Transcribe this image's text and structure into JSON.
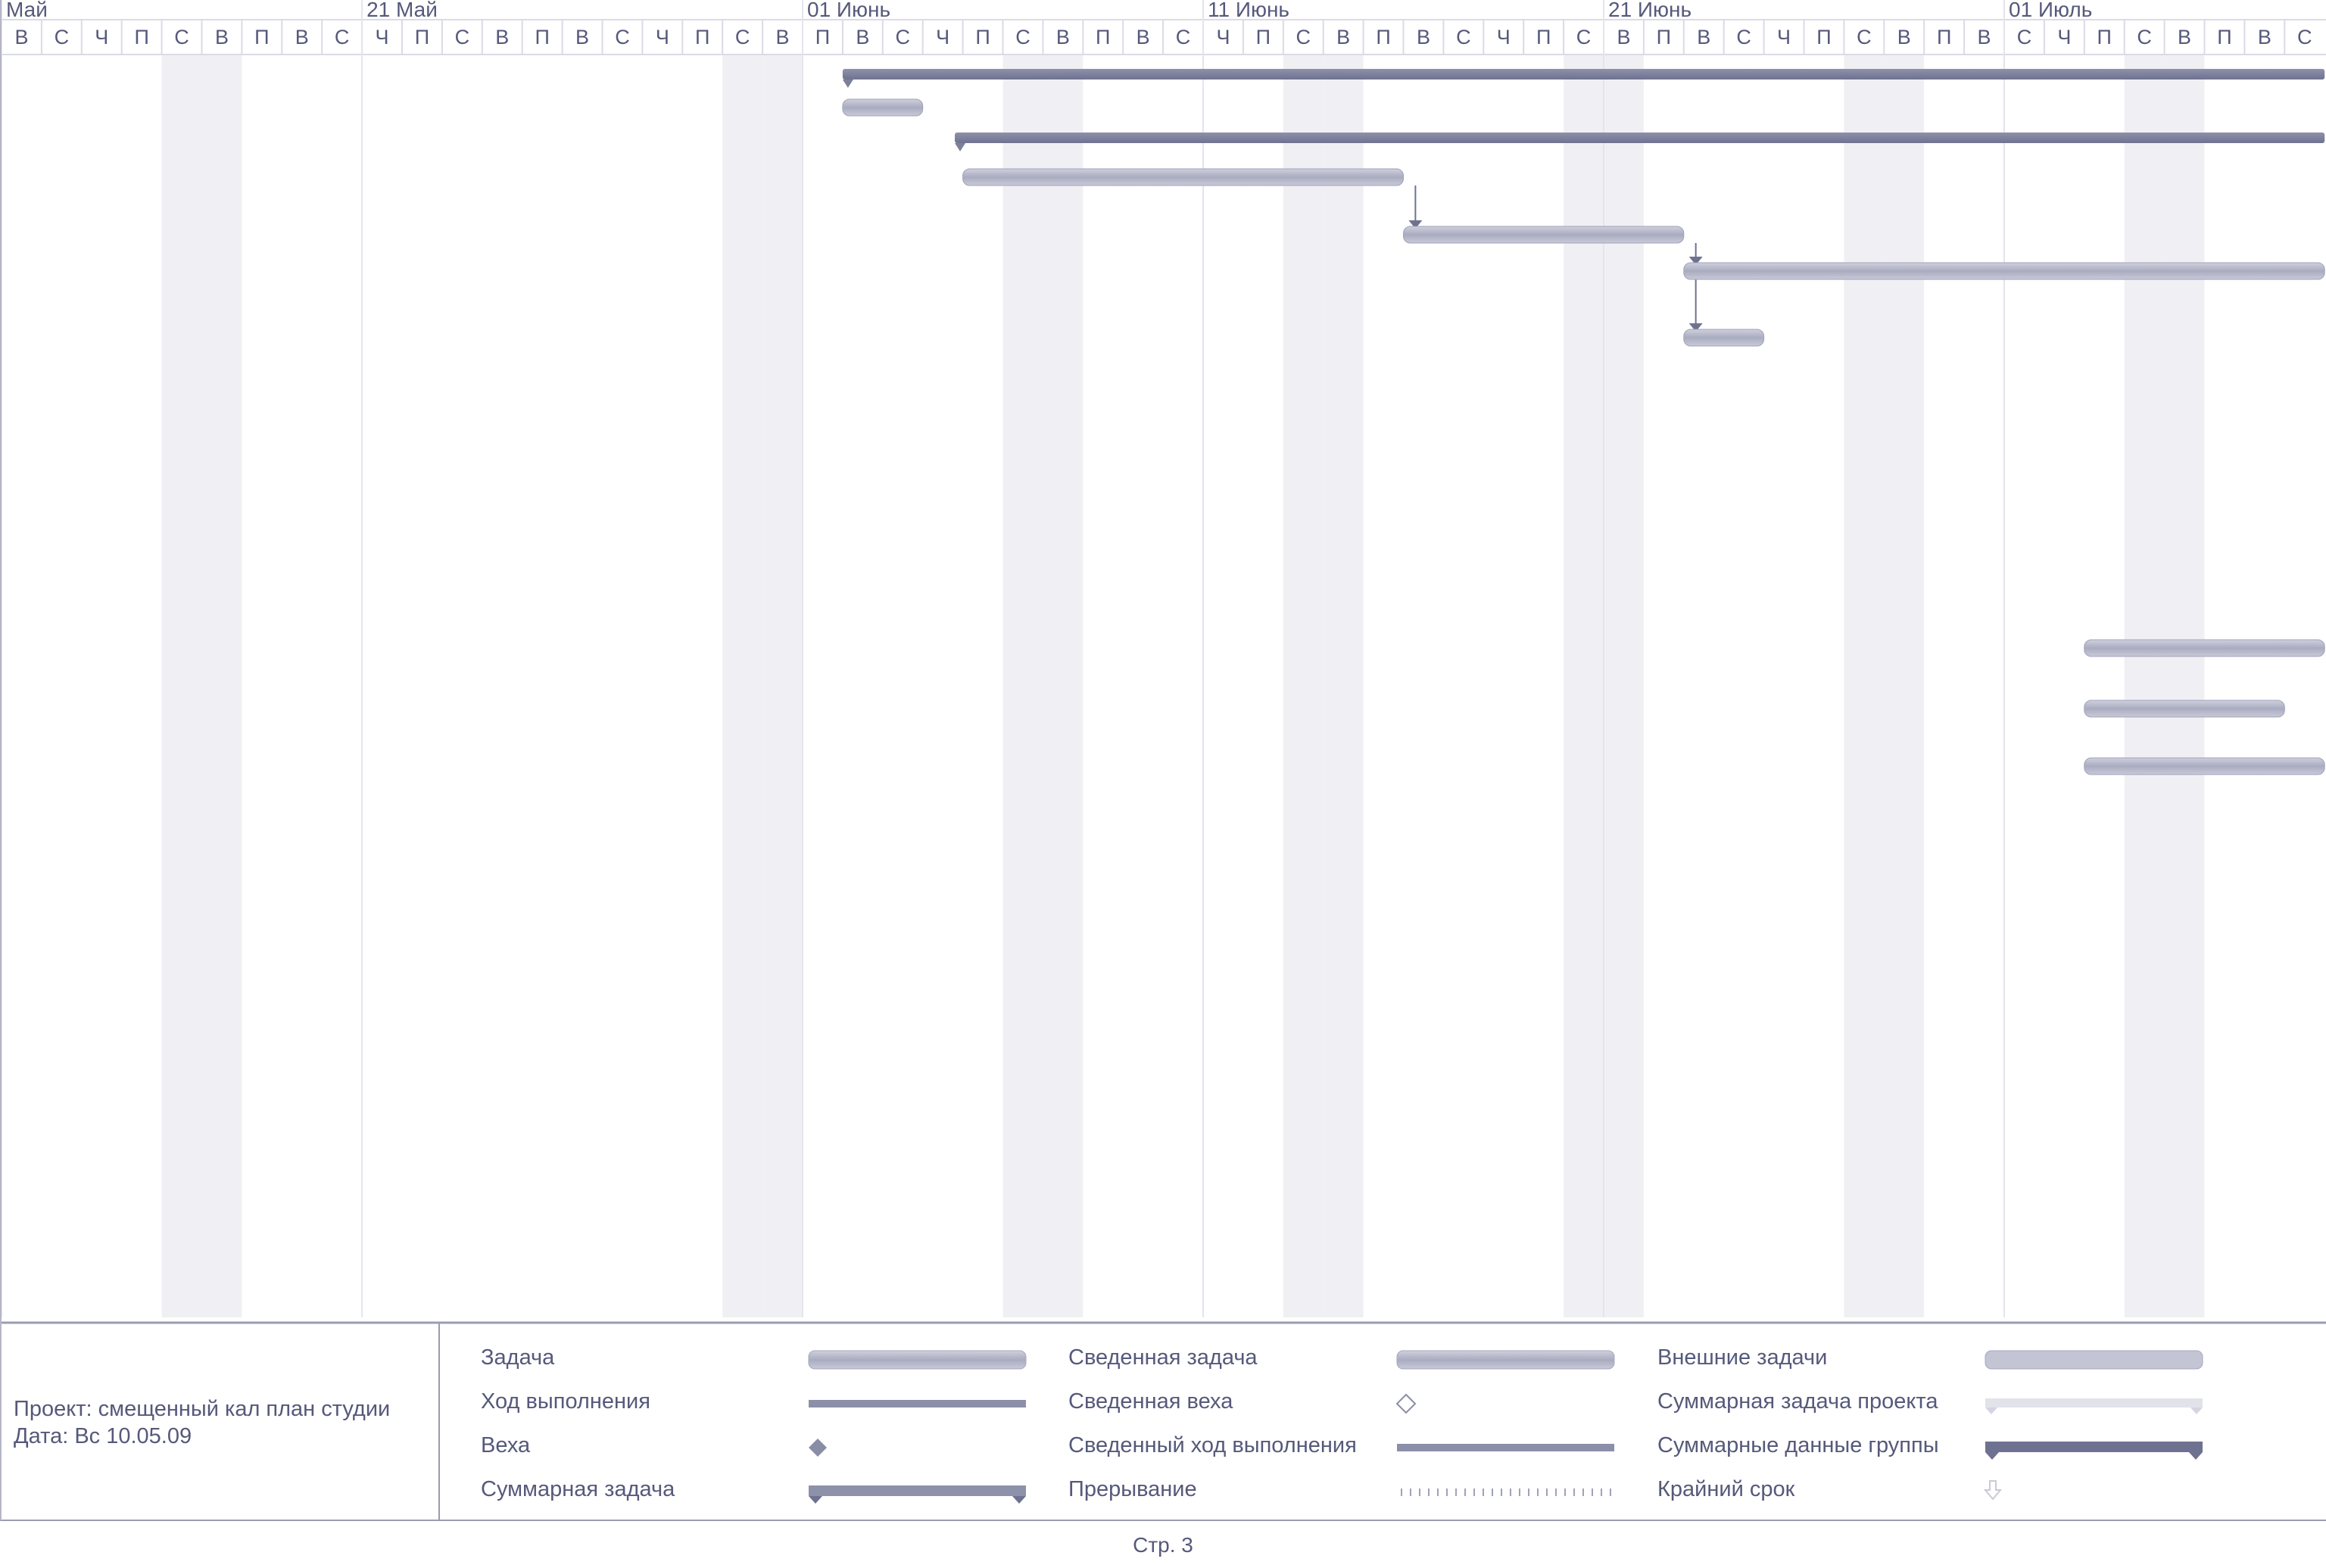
{
  "timescale": {
    "months": [
      {
        "label": "Май",
        "day_index": 0
      },
      {
        "label": "21 Май",
        "day_index": 9
      },
      {
        "label": "01 Июнь",
        "day_index": 20
      },
      {
        "label": "11 Июнь",
        "day_index": 30
      },
      {
        "label": "21 Июнь",
        "day_index": 40
      },
      {
        "label": "01 Июль",
        "day_index": 50
      }
    ],
    "days": [
      "В",
      "С",
      "Ч",
      "П",
      "С",
      "В",
      "П",
      "В",
      "С",
      "Ч",
      "П",
      "С",
      "В",
      "П",
      "В",
      "С",
      "Ч",
      "П",
      "С",
      "В",
      "П",
      "В",
      "С",
      "Ч",
      "П",
      "С",
      "В",
      "П",
      "В",
      "С",
      "Ч",
      "П",
      "С",
      "В",
      "П",
      "В",
      "С",
      "Ч",
      "П",
      "С",
      "В",
      "П",
      "В",
      "С",
      "Ч",
      "П",
      "С",
      "В",
      "П",
      "В",
      "С",
      "Ч",
      "П",
      "С",
      "В",
      "П",
      "В",
      "С"
    ],
    "weekend_day_indices": [
      4,
      5,
      18,
      19,
      25,
      26,
      32,
      33,
      39,
      40,
      46,
      47,
      53,
      54
    ]
  },
  "bars": [
    {
      "type": "summary",
      "row": 0,
      "start_day": 21.0,
      "end_day": 58.0
    },
    {
      "type": "task",
      "row": 1,
      "start_day": 21.0,
      "end_day": 23.0
    },
    {
      "type": "summary",
      "row": 2,
      "start_day": 23.8,
      "end_day": 58.0
    },
    {
      "type": "task",
      "row": 3,
      "start_day": 24.0,
      "end_day": 35.0
    },
    {
      "type": "task",
      "row": 4,
      "start_day": 35.0,
      "end_day": 42.0
    },
    {
      "type": "task",
      "row": 5,
      "start_day": 42.0,
      "end_day": 58.0
    },
    {
      "type": "task",
      "row": 6,
      "start_day": 42.0,
      "end_day": 44.0
    },
    {
      "type": "task",
      "row": 7,
      "start_day": 52.0,
      "end_day": 58.0
    },
    {
      "type": "task",
      "row": 8,
      "start_day": 52.0,
      "end_day": 57.0
    },
    {
      "type": "task",
      "row": 9,
      "start_day": 52.0,
      "end_day": 58.0
    }
  ],
  "links": [
    {
      "from_row": 3,
      "to_row": 4,
      "day": 35.3
    },
    {
      "from_row": 4,
      "to_row": 5,
      "day": 42.3
    },
    {
      "from_row": 5,
      "to_row": 6,
      "day": 42.3
    }
  ],
  "project": {
    "name": "Проект: смещенный кал план студии",
    "date": "Дата: Вс 10.05.09"
  },
  "legend": {
    "col1": [
      {
        "label": "Задача",
        "symbol": "task"
      },
      {
        "label": "Ход выполнения",
        "symbol": "progress"
      },
      {
        "label": "Веха",
        "symbol": "milestone"
      },
      {
        "label": "Суммарная задача",
        "symbol": "summary"
      }
    ],
    "col2": [
      {
        "label": "Сведенная задача",
        "symbol": "task"
      },
      {
        "label": "Сведенная веха",
        "symbol": "milestone-hollow"
      },
      {
        "label": "Сведенный ход выполнения",
        "symbol": "progress"
      },
      {
        "label": "Прерывание",
        "symbol": "split"
      }
    ],
    "col3": [
      {
        "label": "Внешние задачи",
        "symbol": "external"
      },
      {
        "label": "Суммарная задача проекта",
        "symbol": "project-summary"
      },
      {
        "label": "Суммарные данные группы",
        "symbol": "group-summary"
      },
      {
        "label": "Крайний срок",
        "symbol": "deadline"
      }
    ]
  },
  "footer": {
    "page_label": "Стр. 3"
  },
  "colors": {
    "grid": "#dadbe6",
    "weekend_shade": "#f0f0f4",
    "bar": "#b8bacd",
    "bar_dark": "#7d8099",
    "text": "#55597a"
  }
}
